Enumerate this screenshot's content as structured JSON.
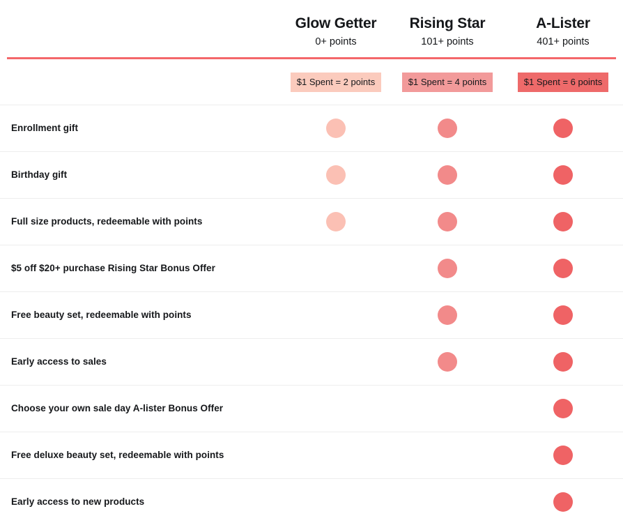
{
  "table": {
    "label_column_header": "",
    "tiers": [
      {
        "name": "Glow Getter",
        "points_threshold": "0+ points",
        "earn_rate": "$1 Spent = 2 points",
        "badge_color": "#FBCBBD",
        "dot_color": "#FBC0B4"
      },
      {
        "name": "Rising Star",
        "points_threshold": "101+ points",
        "earn_rate": "$1 Spent = 4 points",
        "badge_color": "#F29A9A",
        "dot_color": "#F28A8A"
      },
      {
        "name": "A-Lister",
        "points_threshold": "401+ points",
        "earn_rate": "$1 Spent = 6 points",
        "badge_color": "#EE6A6A",
        "dot_color": "#EF6365"
      }
    ],
    "benefits": [
      {
        "label": "Enrollment gift",
        "included": [
          true,
          true,
          true
        ]
      },
      {
        "label": "Birthday gift",
        "included": [
          true,
          true,
          true
        ]
      },
      {
        "label": "Full size products, redeemable with points",
        "included": [
          true,
          true,
          true
        ]
      },
      {
        "label": "$5 off $20+ purchase Rising Star Bonus Offer",
        "included": [
          false,
          true,
          true
        ]
      },
      {
        "label": "Free beauty set, redeemable with points",
        "included": [
          false,
          true,
          true
        ]
      },
      {
        "label": "Early access to sales",
        "included": [
          false,
          true,
          true
        ]
      },
      {
        "label": "Choose your own sale day A-lister Bonus Offer",
        "included": [
          false,
          false,
          true
        ]
      },
      {
        "label": "Free deluxe beauty set, redeemable with points",
        "included": [
          false,
          false,
          true
        ]
      },
      {
        "label": "Early access to new products",
        "included": [
          false,
          false,
          true
        ]
      }
    ]
  },
  "theme": {
    "divider_color": "#F4676A",
    "row_line_color": "#ededed",
    "text_color": "#15171a",
    "background": "#ffffff"
  }
}
